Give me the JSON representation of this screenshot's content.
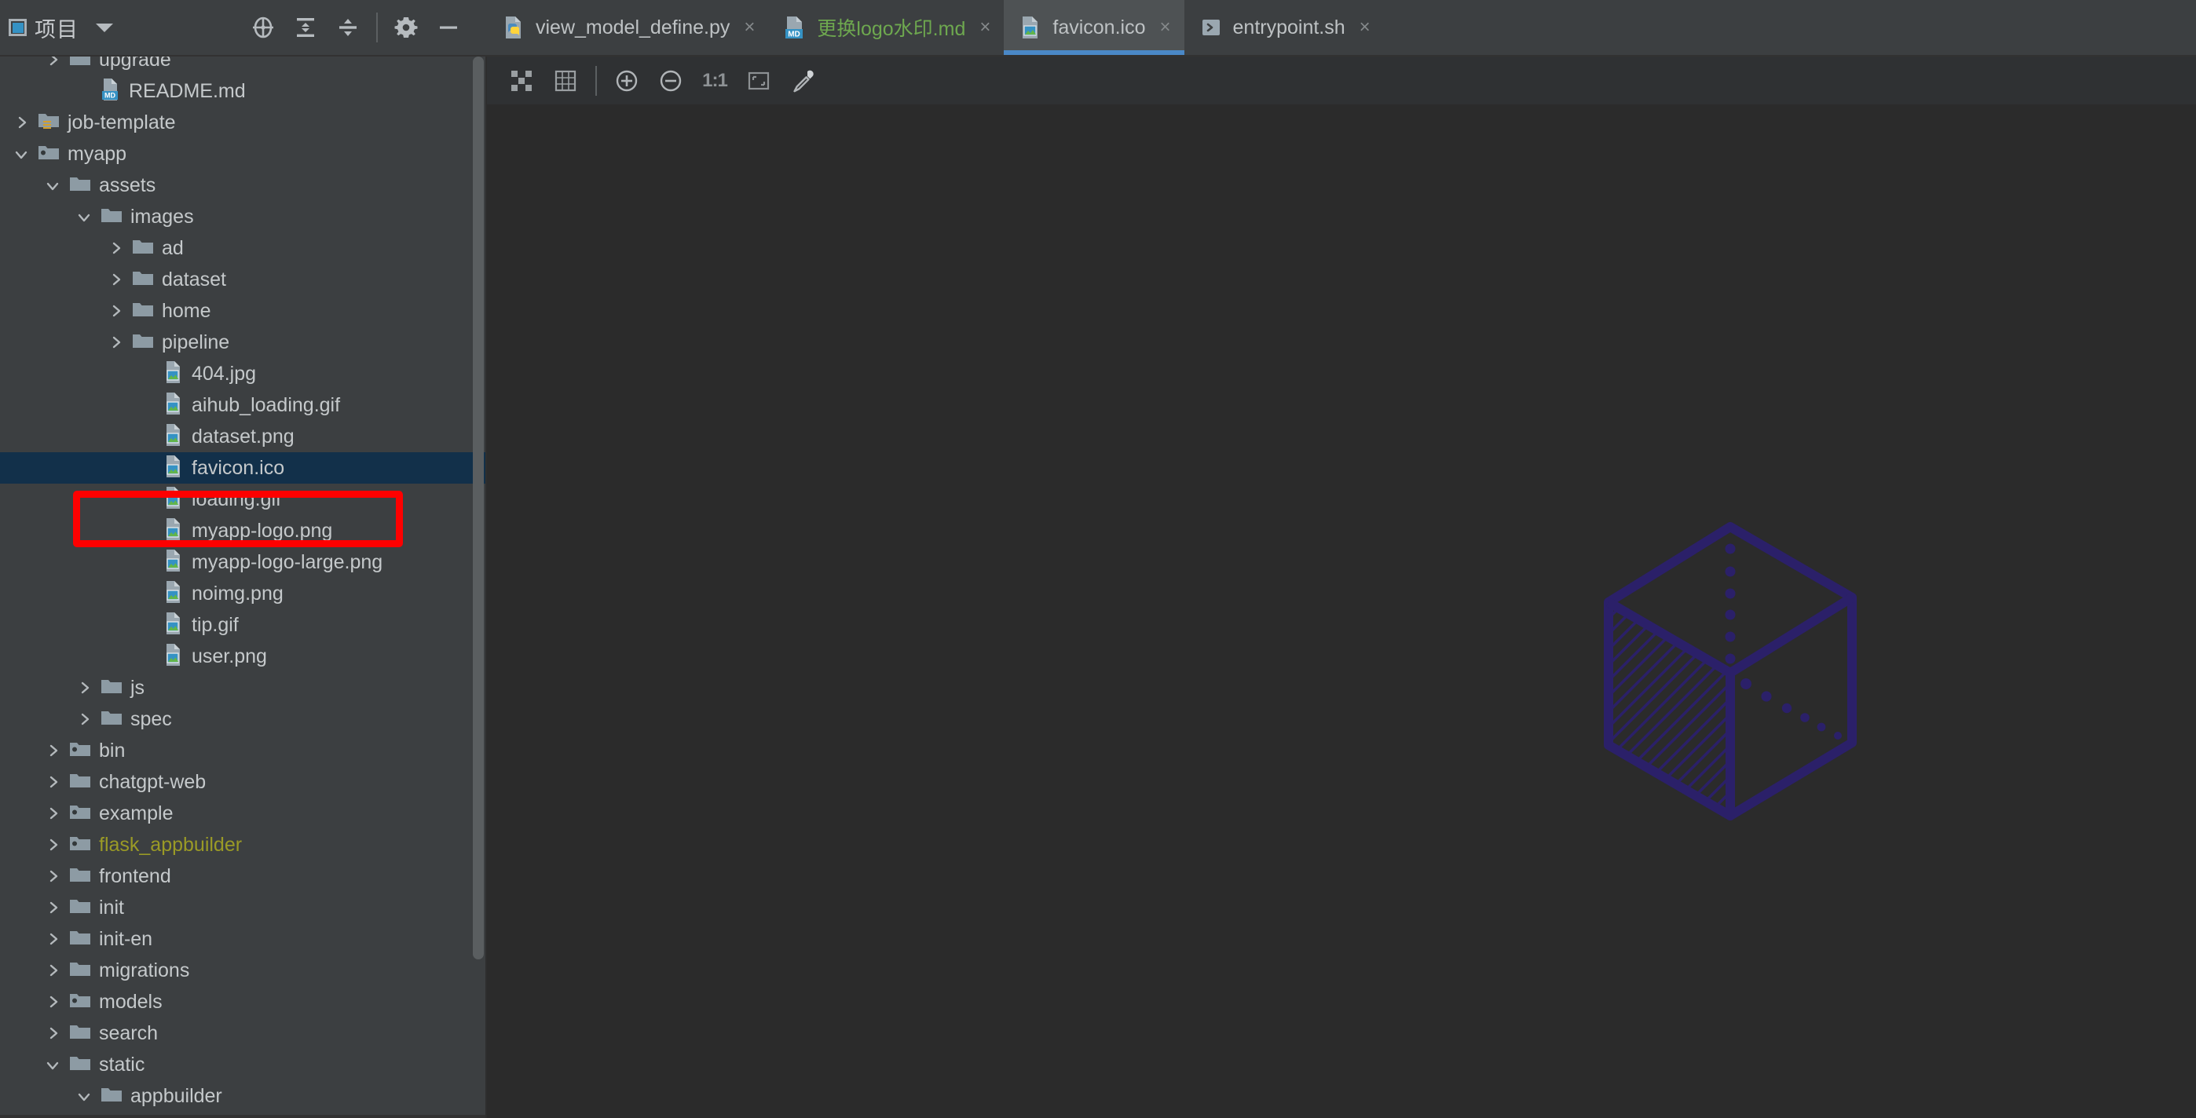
{
  "sidebar": {
    "title": "项目",
    "icon": "project-panel-icon",
    "dropdown_icon": "chevron-down-icon",
    "tools": [
      {
        "name": "locate-file-icon",
        "label": "Select Opened File"
      },
      {
        "name": "expand-all-icon",
        "label": "Expand All"
      },
      {
        "name": "collapse-all-icon",
        "label": "Collapse All"
      },
      {
        "name": "settings-gear-icon",
        "label": "Options"
      },
      {
        "name": "hide-panel-icon",
        "label": "Hide"
      }
    ]
  },
  "tabs": [
    {
      "label": "view_model_define.py",
      "icon": "python-file-icon",
      "active": false,
      "close_label": "×",
      "color": "default"
    },
    {
      "label": "更换logo水印.md",
      "icon": "markdown-file-icon",
      "active": false,
      "close_label": "×",
      "color": "green"
    },
    {
      "label": "favicon.ico",
      "icon": "image-file-icon",
      "active": true,
      "close_label": "×",
      "color": "default"
    },
    {
      "label": "entrypoint.sh",
      "icon": "shell-file-icon",
      "active": false,
      "close_label": "×",
      "color": "default"
    }
  ],
  "image_toolbar": {
    "items": [
      {
        "name": "toggle-transparency-chessboard-icon",
        "label": "Chessboard"
      },
      {
        "name": "toggle-grid-icon",
        "label": "Grid"
      },
      {
        "name": "zoom-in-icon",
        "label": "Zoom In"
      },
      {
        "name": "zoom-out-icon",
        "label": "Zoom Out"
      },
      {
        "name": "actual-size-label",
        "label": "1:1"
      },
      {
        "name": "fit-to-window-icon",
        "label": "Fit Zoom to Window"
      },
      {
        "name": "color-picker-icon",
        "label": "Pick Color"
      }
    ],
    "zoom_level": "1:1"
  },
  "tree": [
    {
      "label": "upgrade",
      "depth": 1,
      "icon": "folder-icon",
      "arrow": "collapsed",
      "selected": false,
      "color": "default"
    },
    {
      "label": "README.md",
      "depth": 2,
      "icon": "markdown-file-icon",
      "arrow": "none",
      "selected": false,
      "color": "default"
    },
    {
      "label": "job-template",
      "depth": 0,
      "icon": "folder-module-icon",
      "arrow": "collapsed",
      "selected": false,
      "color": "default"
    },
    {
      "label": "myapp",
      "depth": 0,
      "icon": "folder-source-icon",
      "arrow": "expanded",
      "selected": false,
      "color": "default"
    },
    {
      "label": "assets",
      "depth": 1,
      "icon": "folder-icon",
      "arrow": "expanded",
      "selected": false,
      "color": "default"
    },
    {
      "label": "images",
      "depth": 2,
      "icon": "folder-icon",
      "arrow": "expanded",
      "selected": false,
      "color": "default"
    },
    {
      "label": "ad",
      "depth": 3,
      "icon": "folder-icon",
      "arrow": "collapsed",
      "selected": false,
      "color": "default"
    },
    {
      "label": "dataset",
      "depth": 3,
      "icon": "folder-icon",
      "arrow": "collapsed",
      "selected": false,
      "color": "default"
    },
    {
      "label": "home",
      "depth": 3,
      "icon": "folder-icon",
      "arrow": "collapsed",
      "selected": false,
      "color": "default"
    },
    {
      "label": "pipeline",
      "depth": 3,
      "icon": "folder-icon",
      "arrow": "collapsed",
      "selected": false,
      "color": "default"
    },
    {
      "label": "404.jpg",
      "depth": 4,
      "icon": "image-file-icon",
      "arrow": "none",
      "selected": false,
      "color": "default"
    },
    {
      "label": "aihub_loading.gif",
      "depth": 4,
      "icon": "image-file-icon",
      "arrow": "none",
      "selected": false,
      "color": "default"
    },
    {
      "label": "dataset.png",
      "depth": 4,
      "icon": "image-file-icon",
      "arrow": "none",
      "selected": false,
      "color": "default"
    },
    {
      "label": "favicon.ico",
      "depth": 4,
      "icon": "image-file-icon",
      "arrow": "none",
      "selected": true,
      "color": "default"
    },
    {
      "label": "loading.gif",
      "depth": 4,
      "icon": "image-file-icon",
      "arrow": "none",
      "selected": false,
      "color": "default"
    },
    {
      "label": "myapp-logo.png",
      "depth": 4,
      "icon": "image-file-icon",
      "arrow": "none",
      "selected": false,
      "color": "default"
    },
    {
      "label": "myapp-logo-large.png",
      "depth": 4,
      "icon": "image-file-icon",
      "arrow": "none",
      "selected": false,
      "color": "default"
    },
    {
      "label": "noimg.png",
      "depth": 4,
      "icon": "image-file-icon",
      "arrow": "none",
      "selected": false,
      "color": "default"
    },
    {
      "label": "tip.gif",
      "depth": 4,
      "icon": "image-file-icon",
      "arrow": "none",
      "selected": false,
      "color": "default"
    },
    {
      "label": "user.png",
      "depth": 4,
      "icon": "image-file-icon",
      "arrow": "none",
      "selected": false,
      "color": "default"
    },
    {
      "label": "js",
      "depth": 2,
      "icon": "folder-icon",
      "arrow": "collapsed",
      "selected": false,
      "color": "default"
    },
    {
      "label": "spec",
      "depth": 2,
      "icon": "folder-icon",
      "arrow": "collapsed",
      "selected": false,
      "color": "default"
    },
    {
      "label": "bin",
      "depth": 1,
      "icon": "folder-source-icon",
      "arrow": "collapsed",
      "selected": false,
      "color": "default"
    },
    {
      "label": "chatgpt-web",
      "depth": 1,
      "icon": "folder-icon",
      "arrow": "collapsed",
      "selected": false,
      "color": "default"
    },
    {
      "label": "example",
      "depth": 1,
      "icon": "folder-source-icon",
      "arrow": "collapsed",
      "selected": false,
      "color": "default"
    },
    {
      "label": "flask_appbuilder",
      "depth": 1,
      "icon": "folder-source-icon",
      "arrow": "collapsed",
      "selected": false,
      "color": "olive"
    },
    {
      "label": "frontend",
      "depth": 1,
      "icon": "folder-icon",
      "arrow": "collapsed",
      "selected": false,
      "color": "default"
    },
    {
      "label": "init",
      "depth": 1,
      "icon": "folder-icon",
      "arrow": "collapsed",
      "selected": false,
      "color": "default"
    },
    {
      "label": "init-en",
      "depth": 1,
      "icon": "folder-icon",
      "arrow": "collapsed",
      "selected": false,
      "color": "default"
    },
    {
      "label": "migrations",
      "depth": 1,
      "icon": "folder-icon",
      "arrow": "collapsed",
      "selected": false,
      "color": "default"
    },
    {
      "label": "models",
      "depth": 1,
      "icon": "folder-source-icon",
      "arrow": "collapsed",
      "selected": false,
      "color": "default"
    },
    {
      "label": "search",
      "depth": 1,
      "icon": "folder-icon",
      "arrow": "collapsed",
      "selected": false,
      "color": "default"
    },
    {
      "label": "static",
      "depth": 1,
      "icon": "folder-icon",
      "arrow": "expanded",
      "selected": false,
      "color": "default"
    },
    {
      "label": "appbuilder",
      "depth": 2,
      "icon": "folder-icon",
      "arrow": "expanded",
      "selected": false,
      "color": "default"
    }
  ],
  "preview": {
    "name": "favicon-cube-preview",
    "description": "Isometric cube outline with hatched left face and dotted hidden edges",
    "stroke_color": "#2b2069",
    "background_color": "#2b2b2b"
  },
  "annotation": {
    "name": "red-highlight-box",
    "target": "favicon.ico",
    "color": "#fe0000"
  },
  "colors": {
    "panel_bg": "#3c3f41",
    "editor_bg": "#2b2b2b",
    "selection_bg": "#12304a",
    "active_tab_bg": "#4e5254",
    "active_tab_underline": "#4a88c7",
    "text": "#c5c9cb",
    "markdown_green": "#6ea84f",
    "olive": "#9a9a26"
  }
}
